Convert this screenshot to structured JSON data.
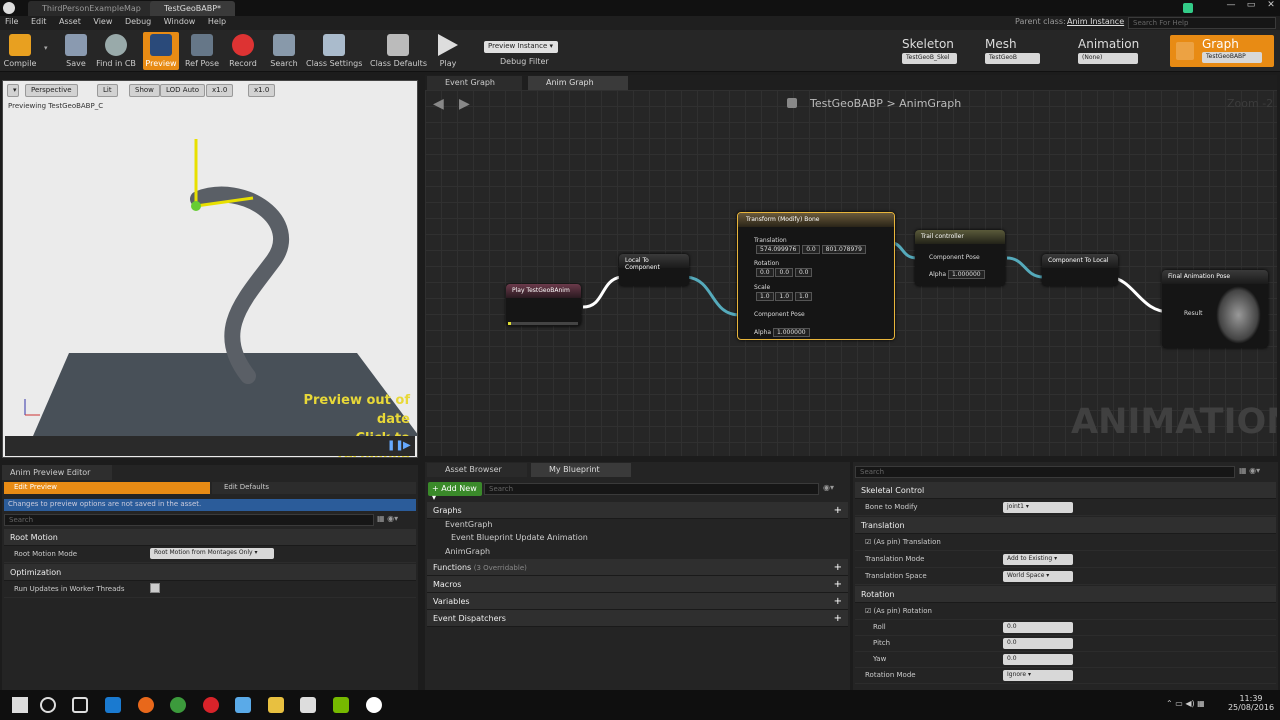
{
  "tabs": [
    "ThirdPersonExampleMap",
    "TestGeoBABP*"
  ],
  "parent_class": {
    "label": "Parent class:",
    "value": "Anim Instance"
  },
  "search_help": "Search For Help",
  "menu": [
    "File",
    "Edit",
    "Asset",
    "View",
    "Debug",
    "Window",
    "Help"
  ],
  "toolbar": {
    "compile": "Compile",
    "save": "Save",
    "find": "Find in CB",
    "preview": "Preview",
    "refpose": "Ref Pose",
    "record": "Record",
    "search": "Search",
    "class_settings": "Class Settings",
    "class_defaults": "Class Defaults",
    "play": "Play",
    "preview_instance": "Preview Instance",
    "debug_filter": "Debug Filter"
  },
  "modes": {
    "skeleton": "Skeleton",
    "skeleton_asset": "TestGeoB_Skel",
    "mesh": "Mesh",
    "mesh_asset": "TestGeoB",
    "animation": "Animation",
    "animation_asset": "(None)",
    "graph": "Graph",
    "graph_asset": "TestGeoBABP"
  },
  "viewport": {
    "perspective": "Perspective",
    "lit": "Lit",
    "show": "Show",
    "lod": "LOD Auto",
    "speed1": "x1.0",
    "speed2": "x1.0",
    "previewing": "Previewing TestGeoBABP_C",
    "out_of_date": "Preview out of date",
    "click_recompile": "Click to recompile"
  },
  "graph_tabs": [
    "Event Graph",
    "Anim Graph"
  ],
  "breadcrumb": {
    "root": "TestGeoBABP",
    "sep": ">",
    "child": "AnimGraph"
  },
  "zoom": "Zoom -2",
  "watermark": "ANIMATION",
  "nodes": {
    "play": "Play TestGeoBAnim",
    "l2c": "Local To Component",
    "transform": "Transform (Modify) Bone",
    "translation": "Translation",
    "tx": "574.099976",
    "ty": "0.0",
    "tz": "801.078979",
    "rotation": "Rotation",
    "r0": "0.0",
    "r1": "0.0",
    "r2": "0.0",
    "scale": "Scale",
    "s0": "1.0",
    "s1": "1.0",
    "s2": "1.0",
    "component_pose": "Component Pose",
    "alpha": "Alpha",
    "alpha_val": "1.000000",
    "trail": "Trail controller",
    "trail_pose": "Component Pose",
    "trail_alpha": "Alpha",
    "trail_alpha_val": "1.000000",
    "c2l": "Component To Local",
    "final": "Final Animation Pose",
    "result": "Result"
  },
  "anim_preview": {
    "tab": "Anim Preview Editor",
    "edit_preview": "Edit Preview",
    "edit_defaults": "Edit Defaults",
    "note": "Changes to preview options are not saved in the asset.",
    "search": "Search",
    "root_motion": "Root Motion",
    "root_motion_mode": "Root Motion Mode",
    "root_motion_value": "Root Motion from Montages Only",
    "optimization": "Optimization",
    "run_updates": "Run Updates in Worker Threads"
  },
  "my_blueprint": {
    "tab1": "Asset Browser",
    "tab2": "My Blueprint",
    "add_new": "Add New",
    "search": "Search",
    "graphs": "Graphs",
    "event_graph": "EventGraph",
    "event_update": "Event Blueprint Update Animation",
    "anim_graph": "AnimGraph",
    "functions": "Functions",
    "functions_count": "(3 Overridable)",
    "macros": "Macros",
    "variables": "Variables",
    "dispatchers": "Event Dispatchers"
  },
  "details": {
    "search": "Search",
    "skeletal_control": "Skeletal Control",
    "bone_to_modify": "Bone to Modify",
    "bone_value": "joint1",
    "translation": "Translation",
    "as_pin_translation": "(As pin) Translation",
    "translation_mode": "Translation Mode",
    "translation_mode_value": "Add to Existing",
    "translation_space": "Translation Space",
    "translation_space_value": "World Space",
    "rotation": "Rotation",
    "as_pin_rotation": "(As pin) Rotation",
    "roll": "Roll",
    "roll_val": "0.0",
    "pitch": "Pitch",
    "pitch_val": "0.0",
    "yaw": "Yaw",
    "yaw_val": "0.0",
    "rotation_mode": "Rotation Mode",
    "rotation_mode_value": "Ignore"
  },
  "clock": {
    "time": "11:39",
    "date": "25/08/2016"
  },
  "colors": {
    "accent": "#e88b14",
    "selected_blue": "#2b5c9a",
    "node_gold": "#e8b53b"
  }
}
